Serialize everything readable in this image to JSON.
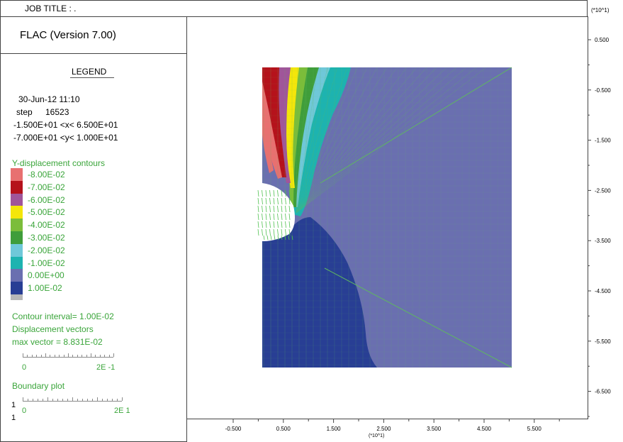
{
  "header": {
    "job_title": "JOB TITLE : .",
    "axis_multiplier": "(*10^1)"
  },
  "program": {
    "name": "FLAC (Version 7.00)"
  },
  "legend": {
    "title": "LEGEND",
    "date": "30-Jun-12 11:10",
    "step_label": "step",
    "step_value": "16523",
    "x_range": "-1.500E+01 <x< 6.500E+01",
    "y_range": "-7.000E+01 <y< 1.000E+01",
    "contours_title": "Y-displacement contours",
    "contour_levels": [
      {
        "label": "-8.00E-02",
        "color": "#e87070"
      },
      {
        "label": "-7.00E-02",
        "color": "#b5121b"
      },
      {
        "label": "-6.00E-02",
        "color": "#a0559a"
      },
      {
        "label": "-5.00E-02",
        "color": "#f4e60a"
      },
      {
        "label": "-4.00E-02",
        "color": "#7bbd3a"
      },
      {
        "label": "-3.00E-02",
        "color": "#3f9d3a"
      },
      {
        "label": "-2.00E-02",
        "color": "#6fc8d9"
      },
      {
        "label": "-1.00E-02",
        "color": "#1db3b0"
      },
      {
        "label": "0.00E+00",
        "color": "#6a6fb0"
      },
      {
        "label": "1.00E-02",
        "color": "#283e94"
      }
    ],
    "last_swatch_color": "#b8b8b8",
    "contour_interval": "Contour interval= 1.00E-02",
    "displacement_vectors": "Displacement vectors",
    "max_vector": "max vector =   8.831E-02",
    "vector_scale_min": "0",
    "vector_scale_max": "2E -1",
    "boundary_plot": "Boundary plot",
    "boundary_scale_min": "0",
    "boundary_scale_max": "2E  1",
    "boundary_side_top": "1",
    "boundary_side_bottom": "1"
  },
  "axes": {
    "y_ticks": [
      "0.500",
      "-0.500",
      "-1.500",
      "-2.500",
      "-3.500",
      "-4.500",
      "-5.500",
      "-6.500"
    ],
    "x_ticks": [
      "-0.500",
      "0.500",
      "1.500",
      "2.500",
      "3.500",
      "4.500",
      "5.500"
    ],
    "x_multiplier": "(*10^1)"
  },
  "colors": {
    "frame": "#444444",
    "legend_text": "#3aa53a",
    "mesh_line": "#5fb85f",
    "vector": "#4ec04e"
  }
}
